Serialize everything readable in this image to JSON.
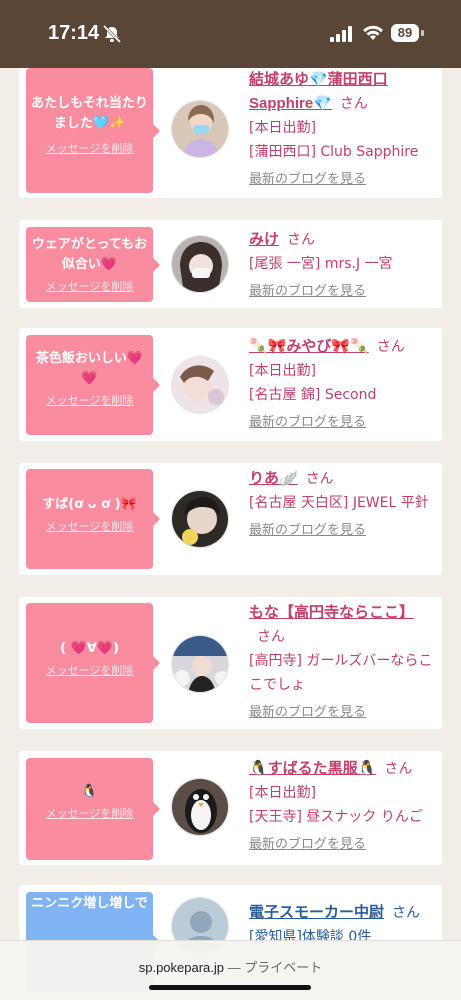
{
  "status_bar": {
    "time": "17:14",
    "battery": "89"
  },
  "cards": [
    {
      "message": "あたしもそれ当たりました🩵✨",
      "delete_label": "メッセージを削除",
      "name": "結城あゆ💎蒲田西口Sapphire💎",
      "honorific": "さん",
      "lines": [
        "[本日出勤]",
        "[蒲田西口] Club Sapphire"
      ],
      "blog_label": "最新のブログを見る"
    },
    {
      "message": "ウェアがとってもお似合い💗",
      "delete_label": "メッセージを削除",
      "name": "みけ",
      "honorific": "さん",
      "lines": [
        "[尾張 一宮] mrs.J 一宮"
      ],
      "blog_label": "最新のブログを見る"
    },
    {
      "message": "茶色飯おいしい💗💗",
      "delete_label": "メッセージを削除",
      "name": "🍡🎀みやび🎀🍡",
      "honorific": "さん",
      "lines": [
        "[本日出勤]",
        "[名古屋 錦] Second"
      ],
      "blog_label": "最新のブログを見る"
    },
    {
      "message": "すば(ơ ᴗ ơ )🎀",
      "delete_label": "メッセージを削除",
      "name": "りあ🪽",
      "honorific": "さん",
      "lines": [
        "[名古屋 天白区] JEWEL 平針"
      ],
      "blog_label": "最新のブログを見る"
    },
    {
      "message": "( 💗∀💗)",
      "delete_label": "メッセージを削除",
      "name": "もな【高円寺ならここ】",
      "honorific": "さん",
      "lines": [
        "[高円寺] ガールズバーならここでしょ"
      ],
      "blog_label": "最新のブログを見る"
    },
    {
      "message": "🐧",
      "delete_label": "メッセージを削除",
      "name": "🐧すばるた黒服🐧",
      "honorific": "さん",
      "lines": [
        "[本日出勤]",
        "[天王寺] 昼スナック りんご"
      ],
      "blog_label": "最新のブログを見る"
    },
    {
      "message": "ニンニク増し増しで",
      "delete_label": "",
      "name": "電子スモーカー中尉",
      "honorific": "さん",
      "lines": [
        "[愛知県]体験談 0件"
      ],
      "blog_label": ""
    }
  ],
  "browser_bar": {
    "domain": "sp.pokepara.jp",
    "mode": "— プライベート"
  },
  "colors": {
    "accent_pink": "#f98c9e",
    "name_pink": "#c2406a",
    "accent_blue": "#7fb3f2",
    "status_brown": "#5a4636"
  }
}
